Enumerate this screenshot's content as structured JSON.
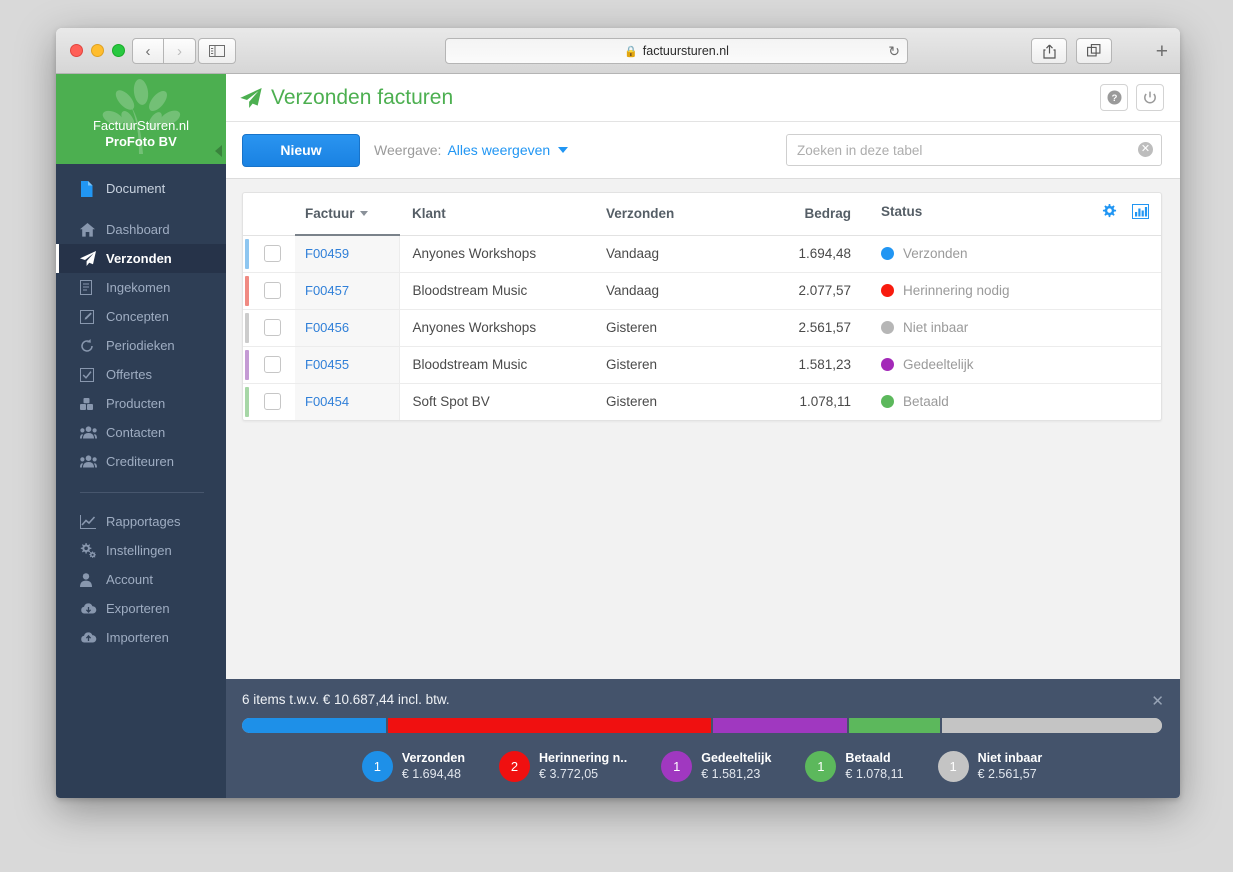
{
  "browser": {
    "url": "factuursturen.nl",
    "lock_icon": "lock-icon",
    "back_label": "‹",
    "forward_label": "›",
    "reload_label": "↻",
    "new_tab_label": "+"
  },
  "sidebar": {
    "logo": {
      "line1": "FactuurSturen.nl",
      "line2": "ProFoto BV"
    },
    "items": [
      {
        "label": "Document",
        "icon": "document-icon",
        "group": "top"
      },
      {
        "label": "Dashboard",
        "icon": "home-icon",
        "group": "main"
      },
      {
        "label": "Verzonden",
        "icon": "paper-plane-icon",
        "group": "main",
        "active": true
      },
      {
        "label": "Ingekomen",
        "icon": "file-icon",
        "group": "main"
      },
      {
        "label": "Concepten",
        "icon": "edit-icon",
        "group": "main"
      },
      {
        "label": "Periodieken",
        "icon": "refresh-icon",
        "group": "main"
      },
      {
        "label": "Offertes",
        "icon": "check-square-icon",
        "group": "main"
      },
      {
        "label": "Producten",
        "icon": "boxes-icon",
        "group": "main"
      },
      {
        "label": "Contacten",
        "icon": "users-icon",
        "group": "main"
      },
      {
        "label": "Crediteuren",
        "icon": "users-icon",
        "group": "main"
      },
      {
        "label": "Rapportages",
        "icon": "chart-line-icon",
        "group": "bottom"
      },
      {
        "label": "Instellingen",
        "icon": "gears-icon",
        "group": "bottom"
      },
      {
        "label": "Account",
        "icon": "user-icon",
        "group": "bottom"
      },
      {
        "label": "Exporteren",
        "icon": "cloud-download-icon",
        "group": "bottom"
      },
      {
        "label": "Importeren",
        "icon": "cloud-upload-icon",
        "group": "bottom"
      }
    ]
  },
  "page": {
    "title": "Verzonden facturen",
    "title_icon": "paper-plane-icon",
    "title_color": "#4caf50",
    "help_icon": "help-circle-icon",
    "power_icon": "power-icon"
  },
  "toolbar": {
    "new_label": "Nieuw",
    "view_label": "Weergave:",
    "view_value": "Alles weergeven",
    "search_placeholder": "Zoeken in deze tabel",
    "search_value": "",
    "clear_icon": "clear-circle-icon"
  },
  "table": {
    "headers": {
      "factuur": "Factuur",
      "klant": "Klant",
      "verzonden": "Verzonden",
      "bedrag": "Bedrag",
      "status": "Status"
    },
    "sort_column": "Factuur",
    "sort_direction": "desc",
    "settings_icon": "gear-icon",
    "chart_icon": "bar-chart-icon",
    "rows": [
      {
        "factuur": "F00459",
        "klant": "Anyones Workshops",
        "verzonden": "Vandaag",
        "bedrag": "1.694,48",
        "status": "Verzonden",
        "color": "#2196f3",
        "bar": "#8ec6f0"
      },
      {
        "factuur": "F00457",
        "klant": "Bloodstream Music",
        "verzonden": "Vandaag",
        "bedrag": "2.077,57",
        "status": "Herinnering nodig",
        "color": "#f81b0e",
        "bar": "#f08a82"
      },
      {
        "factuur": "F00456",
        "klant": "Anyones Workshops",
        "verzonden": "Gisteren",
        "bedrag": "2.561,57",
        "status": "Niet inbaar",
        "color": "#b6b6b6",
        "bar": "#cccccc"
      },
      {
        "factuur": "F00455",
        "klant": "Bloodstream Music",
        "verzonden": "Gisteren",
        "bedrag": "1.581,23",
        "status": "Gedeeltelijk",
        "color": "#a329b8",
        "bar": "#c49ad4"
      },
      {
        "factuur": "F00454",
        "klant": "Soft Spot BV",
        "verzonden": "Gisteren",
        "bedrag": "1.078,11",
        "status": "Betaald",
        "color": "#5cb85c",
        "bar": "#a7d7a7"
      }
    ]
  },
  "summary": {
    "title": "6 items t.w.v. € 10.687,44 incl. btw.",
    "close_icon": "close-icon",
    "legend": [
      {
        "count": "1",
        "name": "Verzonden",
        "amount": "€ 1.694,48",
        "color": "#1e90e8",
        "pct": 15.9
      },
      {
        "count": "2",
        "name": "Herinnering n..",
        "amount": "€ 3.772,05",
        "color": "#f01010",
        "pct": 35.3
      },
      {
        "count": "1",
        "name": "Gedeeltelijk",
        "amount": "€ 1.581,23",
        "color": "#a038c0",
        "pct": 14.8
      },
      {
        "count": "1",
        "name": "Betaald",
        "amount": "€ 1.078,11",
        "color": "#5cb85c",
        "pct": 10.1
      },
      {
        "count": "1",
        "name": "Niet inbaar",
        "amount": "€ 2.561,57",
        "color": "#c4c4c4",
        "pct": 23.9
      }
    ]
  }
}
